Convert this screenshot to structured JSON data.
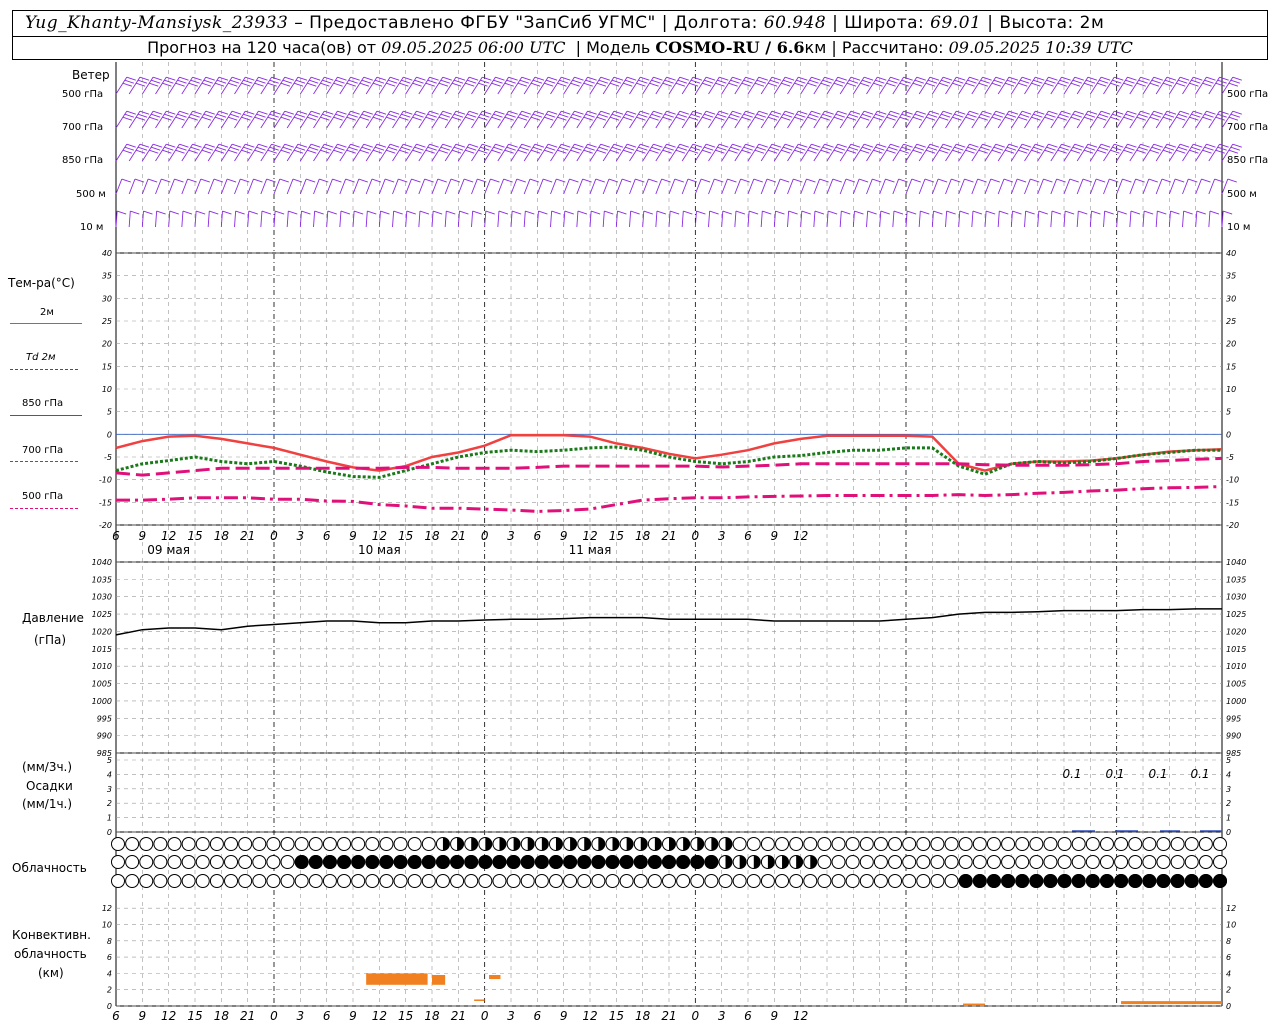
{
  "header": {
    "station": "Yug_Khanty-Mansiysk_23933",
    "provider": "– Предоставлено ФГБУ \"ЗапСиб УГМС\"",
    "lon_label": "Долгота:",
    "lon": "60.948",
    "lat_label": "Широта:",
    "lat": "69.01",
    "alt_label": "Высота:",
    "alt": "2м",
    "forecast_label": "Прогноз на 120 часа(ов) от",
    "forecast_from": "09.05.2025 06:00 UTC",
    "model_label": "Модель",
    "model": "COSMO-RU / 6.6",
    "model_unit": "км",
    "computed_label": "Рассчитано:",
    "computed": "09.05.2025 10:39 UTC"
  },
  "wind_panel": {
    "title": "Ветер",
    "levels": [
      "500 гПа",
      "700 гПа",
      "850 гПа",
      "500 м",
      "10 м"
    ],
    "color": "#8a2be2"
  },
  "temp_panel": {
    "title": "Тем-ра(°С)",
    "legend": [
      {
        "label": "2м",
        "color": "#f04040"
      },
      {
        "label": "Td 2м",
        "color": "#1a7a1a"
      },
      {
        "label": "850 гПа",
        "color": "#e0107a"
      },
      {
        "label": "700 гПа",
        "color": "#e0107a"
      },
      {
        "label": "500 гПа",
        "color": "#e0107a"
      }
    ],
    "ticks": [
      "40",
      "35",
      "30",
      "25",
      "20",
      "15",
      "10",
      "5",
      "0",
      "-5",
      "-10",
      "-15",
      "-20"
    ]
  },
  "pressure_panel": {
    "title": "Давление",
    "unit": "(гПа)",
    "ticks": [
      "1040",
      "1035",
      "1030",
      "1025",
      "1020",
      "1015",
      "1010",
      "1005",
      "1000",
      "995",
      "990",
      "985"
    ]
  },
  "precip_panel": {
    "unit3": "(мм/3ч.)",
    "title": "Осадки",
    "unit1": "(мм/1ч.)",
    "ticks": [
      "5",
      "4",
      "3",
      "2",
      "1",
      "0"
    ],
    "labels": [
      "0.1",
      "0.1",
      "0.1",
      "0.1"
    ]
  },
  "cloud_panel": {
    "title": "Облачность"
  },
  "conv_panel": {
    "title1": "Конвективн.",
    "title2": "облачность",
    "unit": "(км)",
    "ticks": [
      "12",
      "10",
      "8",
      "6",
      "4",
      "2",
      "0"
    ],
    "color": "#f08020"
  },
  "time_axis": {
    "hour_labels": [
      "6",
      "9",
      "12",
      "15",
      "18",
      "21",
      "0",
      "3",
      "6",
      "9",
      "12",
      "15",
      "18",
      "21",
      "0",
      "3",
      "6",
      "9",
      "12",
      "15",
      "18",
      "21",
      "0",
      "3",
      "6",
      "9",
      "12"
    ],
    "dates": [
      "09 мая",
      "10 мая",
      "11 мая"
    ]
  },
  "chart_data": {
    "type": "line",
    "x_hours_from_start": [
      0,
      3,
      6,
      9,
      12,
      15,
      18,
      21,
      24,
      27,
      30,
      33,
      36,
      39,
      42,
      45,
      48,
      51,
      54,
      57,
      60,
      63,
      66,
      69,
      72,
      75,
      78,
      81,
      84,
      87,
      90,
      93,
      96,
      99,
      102,
      105,
      108,
      111,
      114,
      117,
      120,
      123,
      126
    ],
    "series": [
      {
        "name": "2м",
        "values": [
          -3,
          -1.5,
          -0.5,
          -0.3,
          -1,
          -2,
          -3,
          -4.5,
          -6,
          -7.3,
          -8,
          -7,
          -5,
          -4,
          -2.5,
          -0.2,
          -0.2,
          -0.2,
          -0.5,
          -2,
          -3,
          -4.3,
          -5.3,
          -4.5,
          -3.5,
          -2,
          -1,
          -0.3,
          -0.3,
          -0.3,
          -0.3,
          -0.5,
          -6.5,
          -8,
          -6.5,
          -6,
          -6,
          -5.8,
          -5.3,
          -4.5,
          -3.8,
          -3.5,
          -3.3
        ]
      },
      {
        "name": "Td 2м",
        "values": [
          -8,
          -6.5,
          -5.8,
          -5,
          -6,
          -6.5,
          -6,
          -7,
          -8.3,
          -9.3,
          -9.5,
          -8,
          -6.5,
          -5,
          -4,
          -3.5,
          -3.8,
          -3.5,
          -3,
          -2.8,
          -3.5,
          -5,
          -6,
          -6.5,
          -6,
          -5,
          -4.7,
          -4,
          -3.5,
          -3.5,
          -3,
          -3,
          -7,
          -8.8,
          -6.5,
          -6,
          -6.3,
          -6,
          -5.3,
          -4.5,
          -4,
          -3.5,
          -3.5
        ]
      },
      {
        "name": "850 гПа",
        "values": [
          -8.5,
          -9,
          -8.5,
          -8,
          -7.5,
          -7.5,
          -7.5,
          -7.5,
          -7.5,
          -7.5,
          -7.5,
          -7.3,
          -7.3,
          -7.5,
          -7.5,
          -7.5,
          -7.3,
          -7,
          -7,
          -7,
          -7,
          -7,
          -7,
          -7.2,
          -7,
          -6.8,
          -6.5,
          -6.5,
          -6.5,
          -6.5,
          -6.5,
          -6.5,
          -6.5,
          -6.7,
          -6.8,
          -6.8,
          -6.8,
          -6.7,
          -6.5,
          -6,
          -5.8,
          -5.5,
          -5.3
        ]
      },
      {
        "name": "500 гПа",
        "values": [
          -14.5,
          -14.5,
          -14.3,
          -14,
          -14,
          -14,
          -14.3,
          -14.3,
          -14.7,
          -14.8,
          -15.5,
          -15.8,
          -16.3,
          -16.3,
          -16.5,
          -16.7,
          -17,
          -16.8,
          -16.5,
          -15.5,
          -14.5,
          -14.2,
          -14,
          -14,
          -13.8,
          -13.7,
          -13.6,
          -13.5,
          -13.5,
          -13.5,
          -13.5,
          -13.5,
          -13.3,
          -13.5,
          -13.3,
          -13,
          -12.8,
          -12.5,
          -12.3,
          -12,
          -11.8,
          -11.7,
          -11.5
        ]
      }
    ],
    "pressure": [
      1019,
      1020.5,
      1021,
      1021,
      1020.5,
      1021.5,
      1022,
      1022.5,
      1023,
      1023,
      1022.5,
      1022.5,
      1023,
      1023,
      1023.3,
      1023.5,
      1023.5,
      1023.7,
      1024,
      1024,
      1024,
      1023.5,
      1023.5,
      1023.5,
      1023.5,
      1023,
      1023,
      1023,
      1023,
      1023,
      1023.5,
      1024,
      1025,
      1025.5,
      1025.5,
      1025.7,
      1026,
      1026,
      1026,
      1026.3,
      1026.3,
      1026.5,
      1026.5
    ],
    "ylim_temp": [
      -20,
      40
    ],
    "ylim_pressure": [
      985,
      1040
    ],
    "ylim_precip": [
      0,
      5
    ],
    "ylim_conv": [
      0,
      13
    ]
  }
}
